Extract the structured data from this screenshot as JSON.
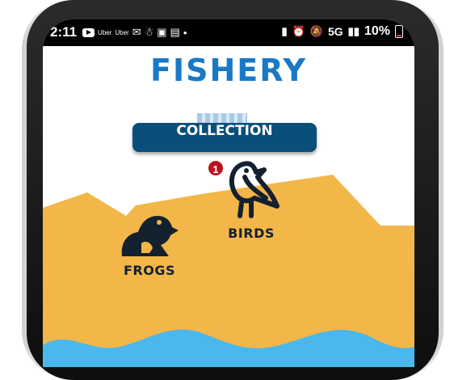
{
  "status_bar": {
    "time": "2:11",
    "notifications": [
      "youtube-icon",
      "Uber",
      "Uber",
      "gmail-icon",
      "app-icon",
      "gallery-icon",
      "image-icon",
      "dot"
    ],
    "uber_1": "Uber",
    "uber_2": "Uber",
    "network": "5G",
    "battery": "10%",
    "battery_level": 0.1
  },
  "app": {
    "title": "FISHERY",
    "collection_button": "COLLECTION",
    "categories": [
      {
        "label": "BIRDS",
        "icon": "bird-icon",
        "badge": "1"
      },
      {
        "label": "FROGS",
        "icon": "frog-icon"
      }
    ]
  },
  "colors": {
    "title": "#1a79c4",
    "button": "#0a4f7a",
    "sand": "#f3b649",
    "water": "#4ab8ec",
    "badge": "#b8141d",
    "icon": "#13212f"
  }
}
